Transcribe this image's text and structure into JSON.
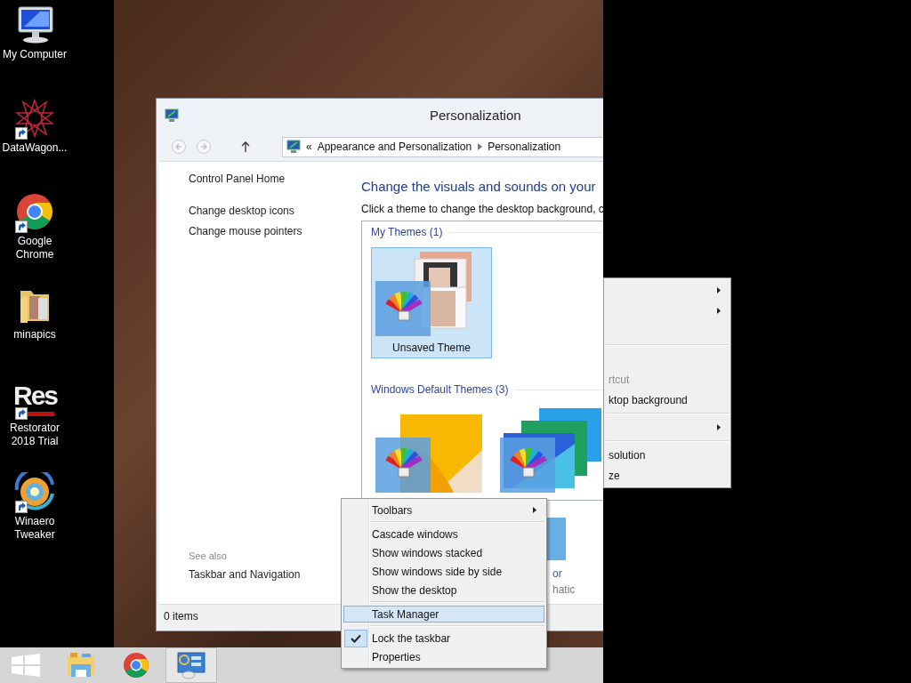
{
  "desktop_icons": [
    {
      "label": "My Computer",
      "kind": "computer",
      "shortcut": false
    },
    {
      "label": "DataWagon...",
      "kind": "star",
      "shortcut": true
    },
    {
      "label": "Google Chrome",
      "kind": "chrome",
      "shortcut": true
    },
    {
      "label": "minapics",
      "kind": "folder",
      "shortcut": false
    },
    {
      "label": "Restorator 2018 Trial",
      "kind": "logo",
      "logo_text": "Res",
      "shortcut": true
    },
    {
      "label": "Winaero Tweaker",
      "kind": "swirl",
      "shortcut": true
    }
  ],
  "window": {
    "title": "Personalization",
    "address_bar": {
      "overflow": "«",
      "crumbs": [
        "Appearance and Personalization",
        "Personalization"
      ]
    },
    "sidebar": {
      "links": [
        "Control Panel Home",
        "Change desktop icons",
        "Change mouse pointers"
      ],
      "see_also_heading": "See also",
      "see_also_links": [
        "Taskbar and Navigation"
      ]
    },
    "heading": "Change the visuals and sounds on your",
    "description": "Click a theme to change the desktop background, c",
    "theme_groups": [
      {
        "title": "My Themes (1)",
        "themes": [
          {
            "name": "Unsaved Theme",
            "kind": "photos",
            "selected": true
          }
        ]
      },
      {
        "title": "Windows Default Themes (3)",
        "themes": [
          {
            "kind": "sunrise",
            "selected": false
          },
          {
            "kind": "panels",
            "selected": false
          }
        ]
      }
    ],
    "partial_theme": {
      "name_part": "or",
      "subtitle_part": "hatic"
    },
    "status_bar": "0 items"
  },
  "desktop_menu": {
    "items": [
      {
        "kind": "item",
        "submenu": true
      },
      {
        "kind": "item",
        "submenu": true
      },
      {
        "kind": "blank"
      },
      {
        "kind": "separator"
      },
      {
        "kind": "blank"
      },
      {
        "kind": "item",
        "label": "rtcut",
        "submenu": false,
        "disabled": true
      },
      {
        "kind": "item",
        "label": "ktop background",
        "submenu": false,
        "disabled": false
      },
      {
        "kind": "separator"
      },
      {
        "kind": "item",
        "submenu": true
      },
      {
        "kind": "separator"
      },
      {
        "kind": "item",
        "label": "solution",
        "submenu": false,
        "disabled": false
      },
      {
        "kind": "item",
        "label": "ze",
        "submenu": false,
        "disabled": false
      }
    ]
  },
  "taskbar_menu": {
    "items": [
      {
        "kind": "item",
        "label": "Toolbars",
        "submenu": true,
        "checked": false,
        "highlighted": false
      },
      {
        "kind": "separator"
      },
      {
        "kind": "item",
        "label": "Cascade windows",
        "submenu": false,
        "checked": false,
        "highlighted": false
      },
      {
        "kind": "item",
        "label": "Show windows stacked",
        "submenu": false,
        "checked": false,
        "highlighted": false
      },
      {
        "kind": "item",
        "label": "Show windows side by side",
        "submenu": false,
        "checked": false,
        "highlighted": false
      },
      {
        "kind": "item",
        "label": "Show the desktop",
        "submenu": false,
        "checked": false,
        "highlighted": false
      },
      {
        "kind": "separator"
      },
      {
        "kind": "item",
        "label": "Task Manager",
        "submenu": false,
        "checked": false,
        "highlighted": true
      },
      {
        "kind": "separator"
      },
      {
        "kind": "item",
        "label": "Lock the taskbar",
        "submenu": false,
        "checked": true,
        "highlighted": false
      },
      {
        "kind": "item",
        "label": "Properties",
        "submenu": false,
        "checked": false,
        "highlighted": false
      }
    ]
  },
  "taskbar": {
    "buttons": [
      {
        "kind": "start",
        "active": false
      },
      {
        "kind": "explorer",
        "active": false
      },
      {
        "kind": "chrome",
        "active": false
      },
      {
        "kind": "control-panel",
        "active": true
      }
    ]
  }
}
